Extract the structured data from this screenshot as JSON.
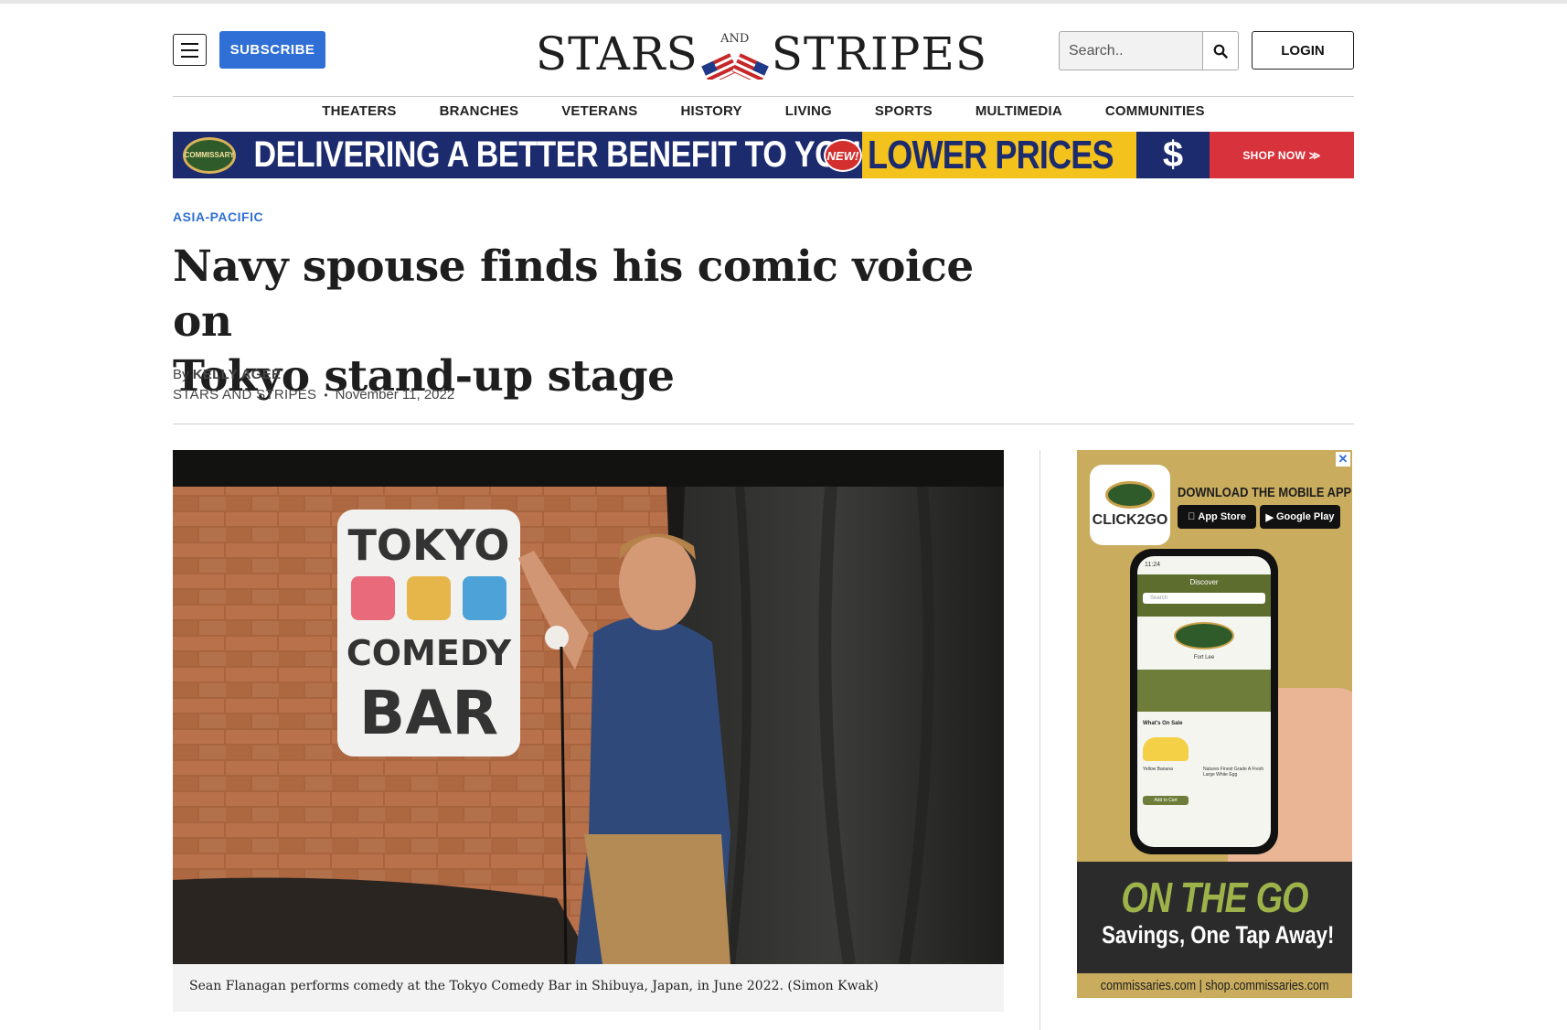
{
  "header": {
    "subscribe_label": "SUBSCRIBE",
    "logo_left": "STARS",
    "logo_and": "AND",
    "logo_right": "STRIPES",
    "search_placeholder": "Search..",
    "login_label": "LOGIN"
  },
  "nav": {
    "items": [
      "THEATERS",
      "BRANCHES",
      "VETERANS",
      "HISTORY",
      "LIVING",
      "SPORTS",
      "MULTIMEDIA",
      "COMMUNITIES"
    ]
  },
  "top_ad": {
    "badge": "COMMISSARY",
    "headline": "DELIVERING A BETTER BENEFIT TO YOU",
    "new_label": "NEW!",
    "lower_prices": "LOWER PRICES",
    "dollar": "$",
    "shop_now": "SHOP NOW ≫"
  },
  "article": {
    "category": "ASIA-PACIFIC",
    "title_line1": "Navy spouse finds his comic voice on",
    "title_line2": "Tokyo stand-up stage",
    "by_prefix": "By",
    "author": "KELLY AGEE",
    "source": "STARS AND STRIPES",
    "separator": "•",
    "date": "November 11, 2022",
    "photo_sign": [
      "TOKYO",
      "COMEDY",
      "BAR"
    ],
    "caption": "Sean Flanagan performs comedy at the Tokyo Comedy Bar in Shibuya, Japan, in June 2022. (Simon Kwak)"
  },
  "side_ad": {
    "close": "✕",
    "logo_text": "CLICK2GO",
    "logo_prefix": "COMMISSARY",
    "download": "DOWNLOAD THE MOBILE APP",
    "app_store": "App Store",
    "google_play": "Google Play",
    "on_the_go": "ON THE GO",
    "savings": "Savings, One Tap Away!",
    "urls": "commissaries.com | shop.commissaries.com",
    "phone_time": "11:24",
    "phone_title": "Discover",
    "phone_search": "Search",
    "phone_section": "What's On Sale",
    "phone_item1": "Yellow Banana",
    "phone_item2": "Natures Finest Grade A Fresh Large White Egg",
    "phone_add": "Add to Cart",
    "phone_store": "Fort Lee"
  },
  "colors": {
    "accent_blue": "#2f6fd6",
    "ad_navy": "#1c2a6e",
    "ad_yellow": "#f3c21d",
    "ad_red": "#d8333c",
    "side_ad_gold": "#c9ac5e"
  }
}
